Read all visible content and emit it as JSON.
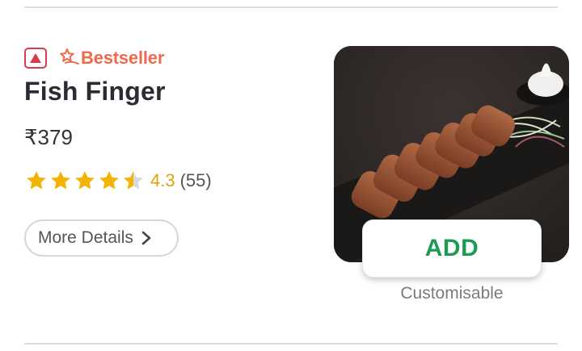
{
  "item": {
    "badge": {
      "type_icon": "non-veg-triangle-icon",
      "bestseller_icon": "star-swoosh-icon",
      "bestseller_label": "Bestseller"
    },
    "name": "Fish Finger",
    "price": "₹379",
    "rating": {
      "value": "4.3",
      "stars_filled": 4.5,
      "stars_total": 5,
      "count": "(55)"
    },
    "more_details_label": "More Details",
    "more_details_icon": "chevron-right-icon",
    "image_icon": "fish-finger-photo",
    "add_label": "ADD",
    "customisable_label": "Customisable"
  },
  "colors": {
    "accent_green": "#1d9b52",
    "star_yellow": "#f5b301",
    "bestseller_orange": "#ef6a4c",
    "nonveg_red": "#d9394a"
  }
}
